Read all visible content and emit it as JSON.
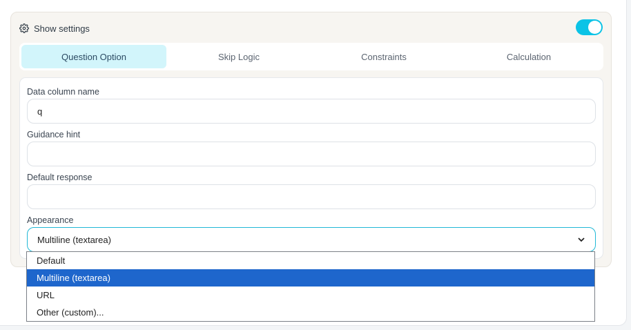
{
  "panel": {
    "title": "Show settings",
    "toggle_on": true,
    "accent": "#0bc3e6"
  },
  "tabs": [
    {
      "label": "Question Option",
      "active": true
    },
    {
      "label": "Skip Logic",
      "active": false
    },
    {
      "label": "Constraints",
      "active": false
    },
    {
      "label": "Calculation",
      "active": false
    }
  ],
  "form": {
    "data_column": {
      "label": "Data column name",
      "value": "q"
    },
    "guidance": {
      "label": "Guidance hint",
      "value": ""
    },
    "default_response": {
      "label": "Default response",
      "value": ""
    },
    "appearance": {
      "label": "Appearance",
      "selected": "Multiline (textarea)",
      "options": [
        "Default",
        "Multiline (textarea)",
        "URL",
        "Other (custom)..."
      ]
    }
  },
  "selection_color": "#1e66cc"
}
